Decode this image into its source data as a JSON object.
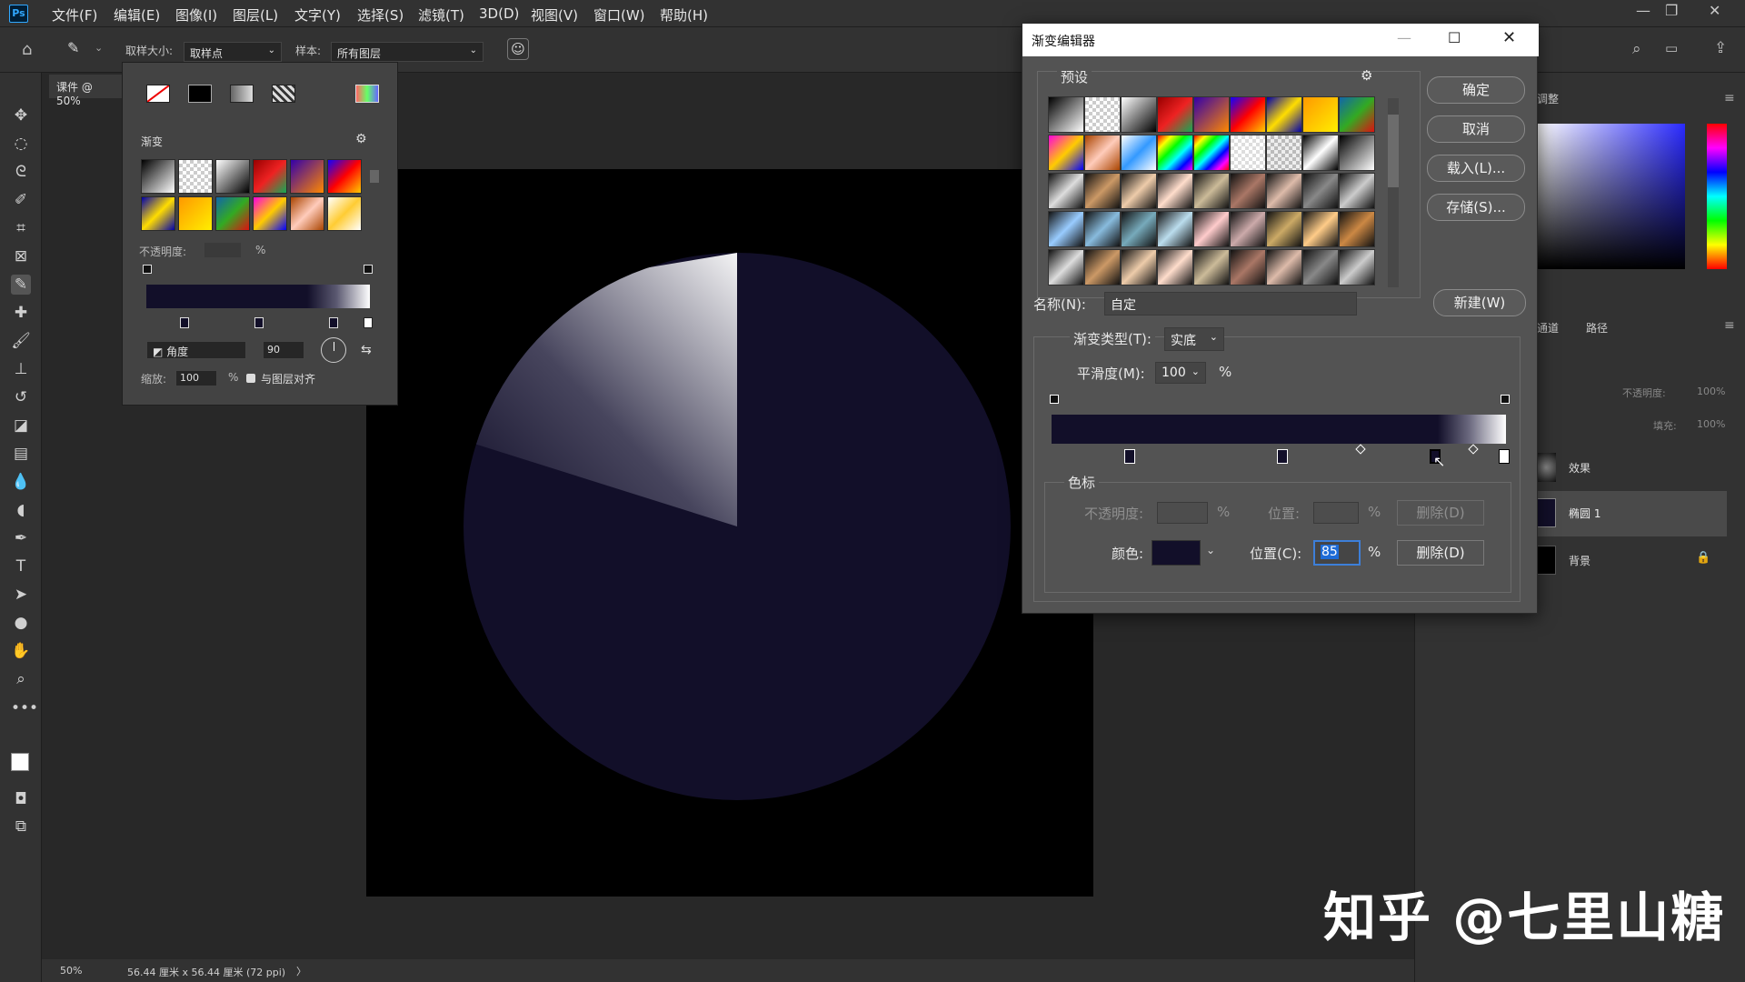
{
  "menubar": {
    "logo": "Ps",
    "items": [
      "文件(F)",
      "编辑(E)",
      "图像(I)",
      "图层(L)",
      "文字(Y)",
      "选择(S)",
      "滤镜(T)",
      "3D(D)",
      "视图(V)",
      "窗口(W)",
      "帮助(H)"
    ]
  },
  "options": {
    "sample_size_label": "取样大小:",
    "sample_size_value": "取样点",
    "sample_label": "样本:",
    "sample_value": "所有图层"
  },
  "document": {
    "tab_title": "课件 @ 50%",
    "zoom": "50%",
    "doc_info": "56.44 厘米 x 56.44 厘米 (72 ppi)"
  },
  "picker": {
    "gradients_label": "渐变",
    "opacity_label": "不透明度:",
    "opacity_unit": "%",
    "style_value": "角度",
    "angle_value": "90",
    "scale_label": "缩放:",
    "scale_value": "100",
    "scale_unit": "%",
    "align_label": "与图层对齐"
  },
  "dialog": {
    "title": "渐变编辑器",
    "presets_label": "预设",
    "ok": "确定",
    "cancel": "取消",
    "load": "载入(L)...",
    "save": "存储(S)...",
    "name_label": "名称(N):",
    "name_value": "自定",
    "new_button": "新建(W)",
    "type_label": "渐变类型(T):",
    "type_value": "实底",
    "smooth_label": "平滑度(M):",
    "smooth_value": "100",
    "smooth_unit": "%",
    "stops_label": "色标",
    "opacity_label": "不透明度:",
    "opacity_unit": "%",
    "opacity_pos_label": "位置:",
    "opacity_pos_unit": "%",
    "opacity_delete": "删除(D)",
    "color_label": "颜色:",
    "color_pos_label": "位置(C):",
    "color_pos_value": "85",
    "color_pos_unit": "%",
    "color_delete": "删除(D)"
  },
  "panels": {
    "adjust_tab": "调整",
    "channels_tab": "通道",
    "paths_tab": "路径",
    "opacity_label": "不透明度:",
    "opacity_value": "100%",
    "fill_label": "填充:",
    "fill_value": "100%",
    "layers": [
      {
        "name": "效果"
      },
      {
        "name": "椭圆 1"
      },
      {
        "name": "背景"
      }
    ]
  },
  "watermark": "知乎 @七里山糖",
  "colors": {
    "circle": "#120f29",
    "accent": "#31a8ff"
  }
}
